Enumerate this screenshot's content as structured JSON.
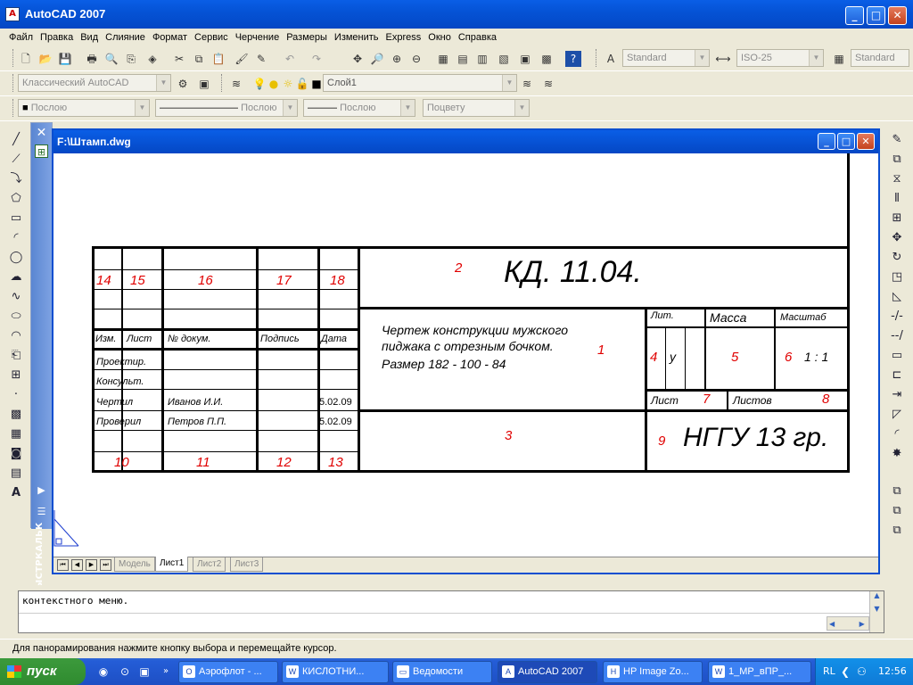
{
  "app": {
    "title": "AutoCAD 2007",
    "icon": "autocad-app-icon"
  },
  "window_controls": {
    "minimize": "_",
    "maximize": "□",
    "close": "✕"
  },
  "menu": [
    "Файл",
    "Правка",
    "Вид",
    "Слияние",
    "Формат",
    "Сервис",
    "Черчение",
    "Размеры",
    "Изменить",
    "Express",
    "Окно",
    "Справка"
  ],
  "toolbar": {
    "text_style": "Standard",
    "dim_style": "ISO-25",
    "table_style": "Standard",
    "workspace": "Классический AutoCAD",
    "layer": "Слой1",
    "color": "Послою",
    "linetype": "Послою",
    "lineweight": "Послою",
    "plotstyle": "Поцвету"
  },
  "quickcalc": {
    "label": "БЫСТРКАЛЬК"
  },
  "document": {
    "title": "F:\\Штамп.dwg"
  },
  "title_block": {
    "designation": "КД. 11.04.",
    "drawing_name": [
      "Чертеж конструкции мужского",
      "пиджака с отрезным бочком.",
      "Размер 182 - 100 - 84"
    ],
    "org": "НГГУ 13 гр.",
    "scale": "1 : 1",
    "letter": "у",
    "headers": {
      "izm": "Изм.",
      "list": "Лист",
      "doc": "№ докум.",
      "sign": "Подпись",
      "date": "Дата",
      "lit": "Лит.",
      "mass": "Масса",
      "scale": "Масштаб",
      "sheet": "Лист",
      "sheets": "Листов"
    },
    "roles": [
      "Проектир.",
      "Консульт.",
      "Чертил",
      "Проверил"
    ],
    "names": {
      "drawn": "Иванов И.И.",
      "checked": "Петров П.П."
    },
    "dates": {
      "drawn": "5.02.09",
      "checked": "5.02.09"
    },
    "markers": {
      "m1": "1",
      "m2": "2",
      "m3": "3",
      "m4": "4",
      "m5": "5",
      "m6": "6",
      "m7": "7",
      "m8": "8",
      "m9": "9",
      "m10": "10",
      "m11": "11",
      "m12": "12",
      "m13": "13",
      "m14": "14",
      "m15": "15",
      "m16": "16",
      "m17": "17",
      "m18": "18"
    }
  },
  "layout_tabs": [
    "Модель",
    "Лист1",
    "Лист2",
    "Лист3"
  ],
  "command_line": "контекстного меню.",
  "status": "Для панорамирования нажмите кнопку выбора и перемещайте курсор.",
  "taskbar": {
    "start": "пуск",
    "tasks": [
      "Аэрофлот - ...",
      "КИСЛОТНИ...",
      "Ведомости",
      "AutoCAD 2007",
      "HP Image Zo...",
      "1_МР_вПР_..."
    ],
    "lang": "RL",
    "clock": "12:56"
  },
  "colors": {
    "accent_red": "#e00000",
    "xp_blue": "#0a5ee6",
    "start_green": "#3c9a3c"
  }
}
